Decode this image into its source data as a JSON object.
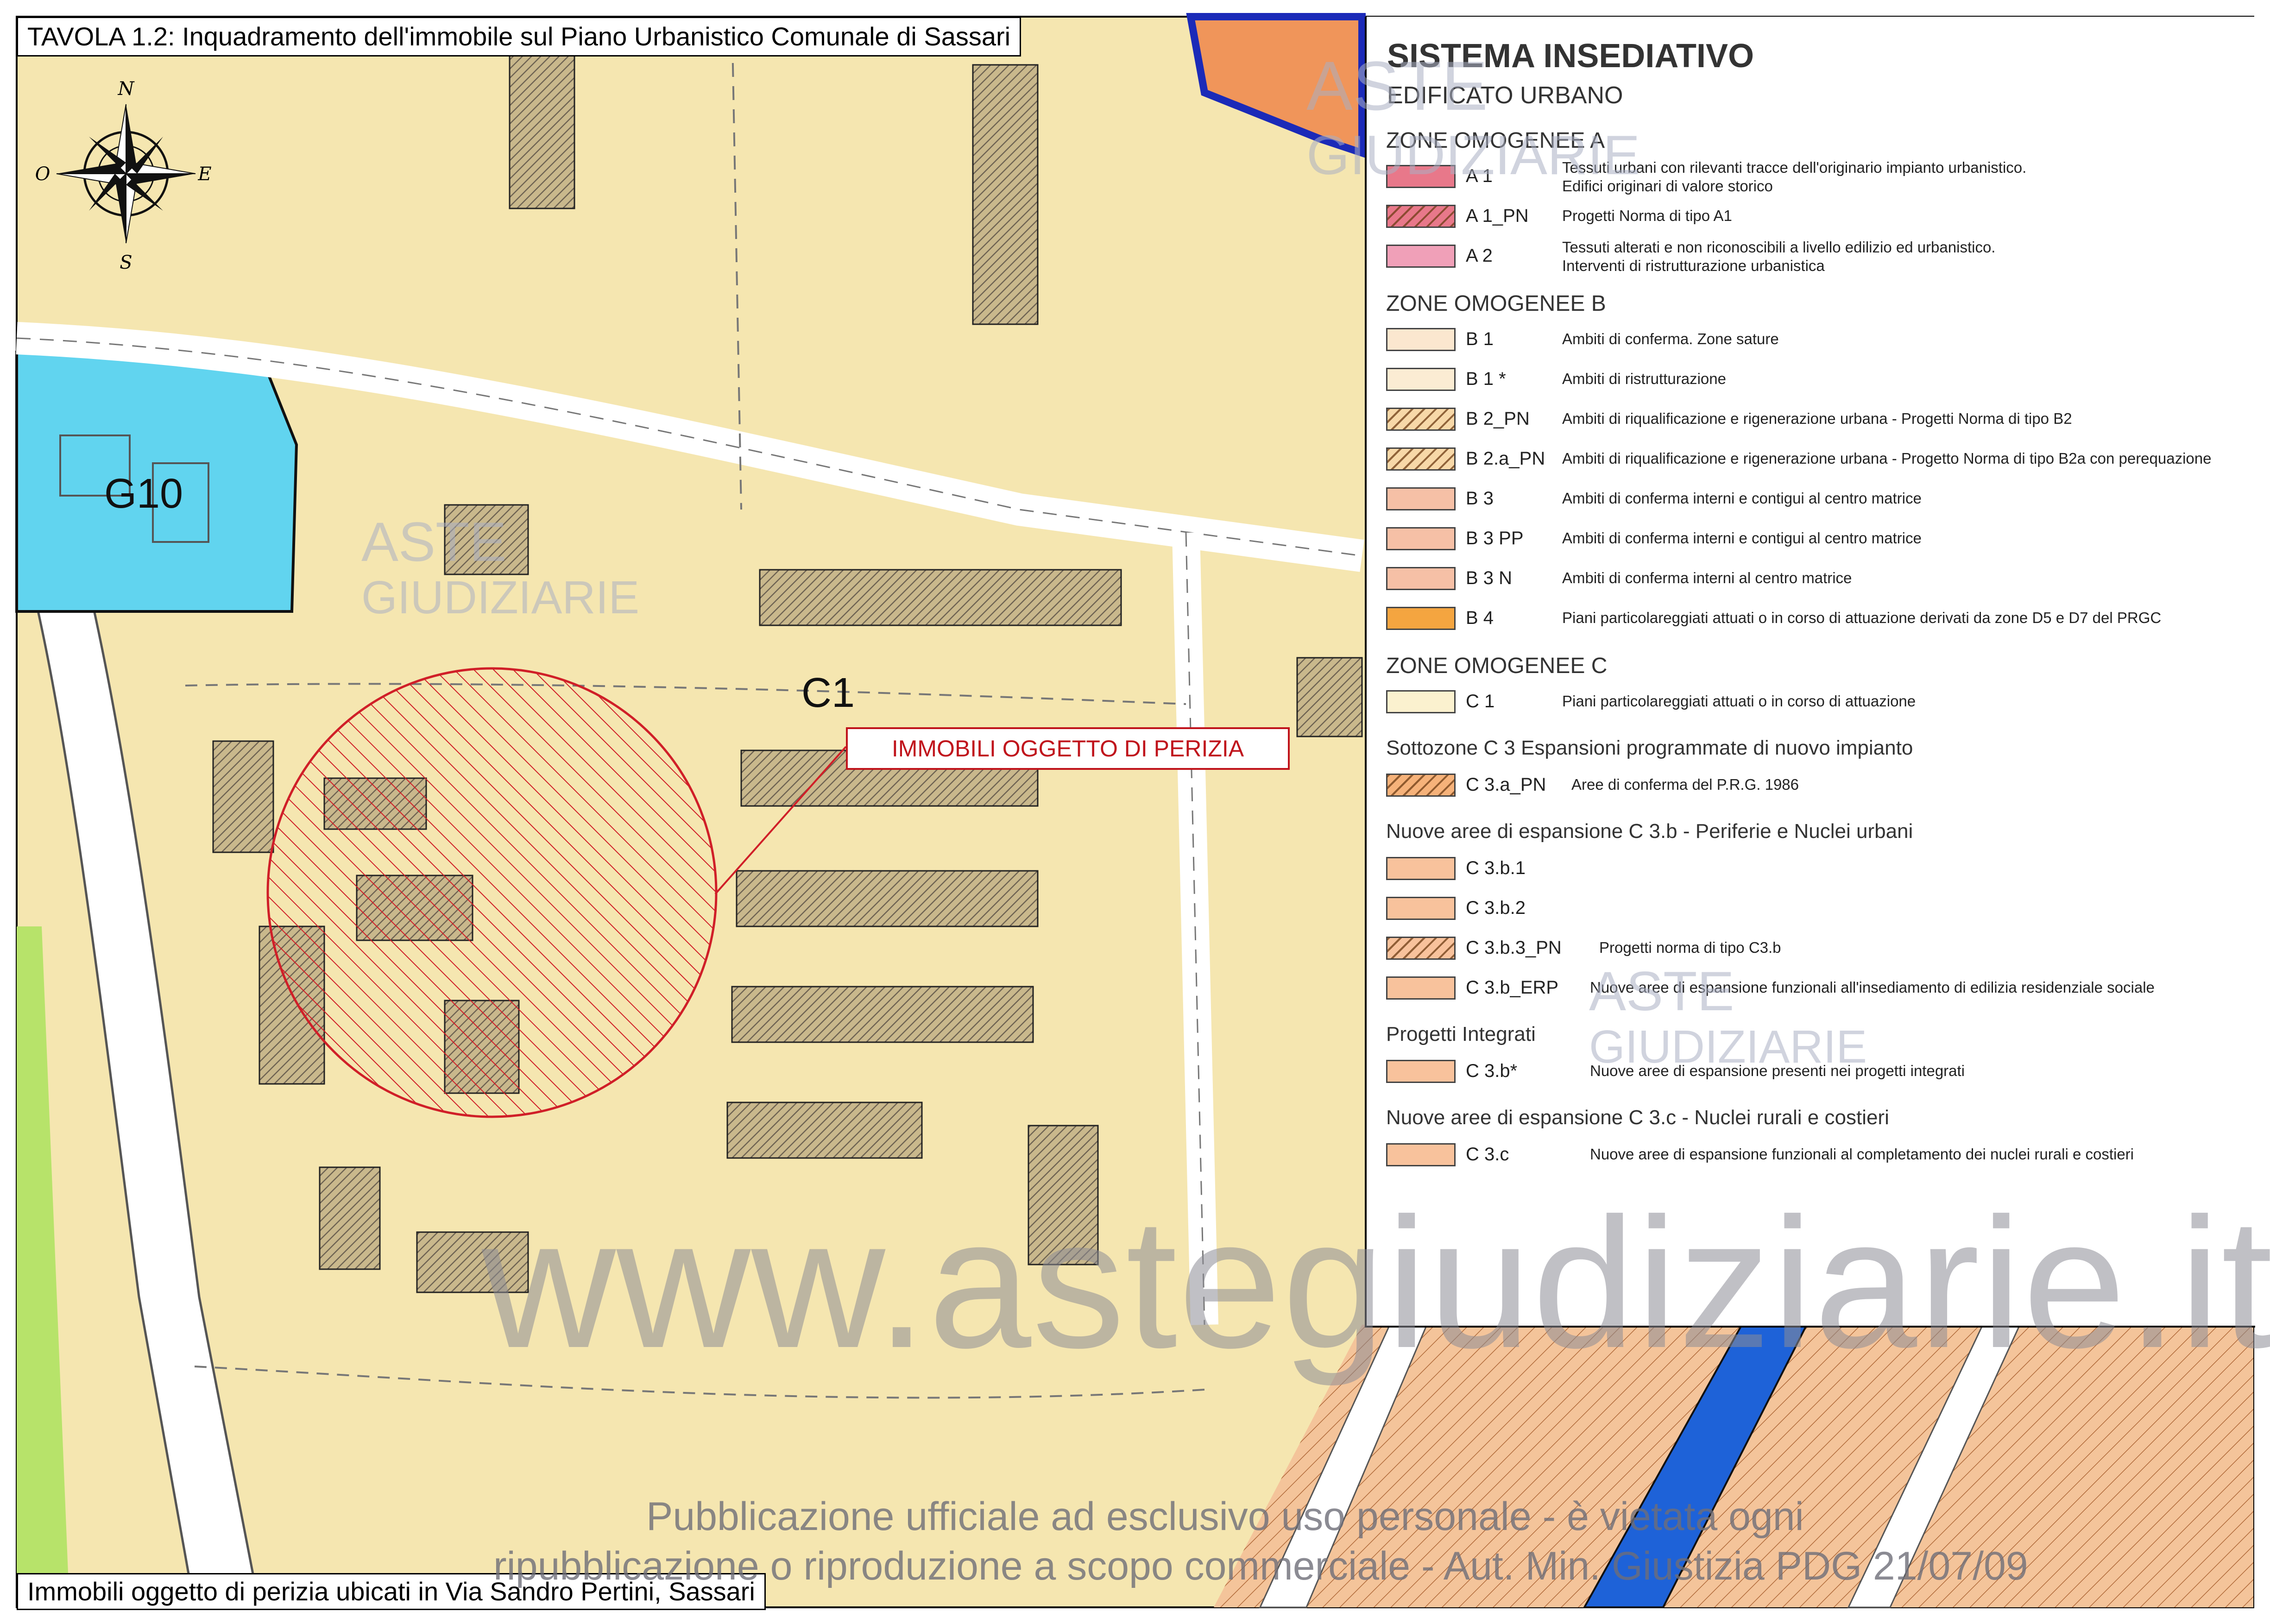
{
  "title": "TAVOLA 1.2: Inquadramento dell'immobile sul Piano Urbanistico Comunale di Sassari",
  "caption": "Immobili oggetto di perizia ubicati in Via Sandro Pertini, Sassari",
  "callout": "IMMOBILI OGGETTO DI PERIZIA",
  "compass": {
    "n": "N",
    "s": "S",
    "e": "E",
    "o": "O"
  },
  "zone_labels": {
    "g10": "G10",
    "c1": "C1"
  },
  "colors": {
    "map_base": "#f5e6b0",
    "service_zone": "#61d4ef",
    "highlight": "#d01f28",
    "road_blue": "#1e62d8",
    "green_strip": "#b7e36a",
    "building_hatch": "#b3a27a"
  },
  "legend": {
    "title": "SISTEMA INSEDIATIVO",
    "subtitle": "EDIFICATO URBANO",
    "sections": [
      {
        "heading": "ZONE OMOGENEE A",
        "items": [
          {
            "code": "A 1",
            "desc": "Tessuti urbani con rilevanti tracce dell'originario impianto urbanistico.",
            "desc2": "Edifici originari di valore storico",
            "color": "#e8788a",
            "hatch": false
          },
          {
            "code": "A 1_PN",
            "desc": "Progetti Norma di tipo A1",
            "desc2": "",
            "color": "#e8788a",
            "hatch": true
          },
          {
            "code": "A 2",
            "desc": "Tessuti alterati e non riconoscibili a livello edilizio ed urbanistico.",
            "desc2": "Interventi di ristrutturazione urbanistica",
            "color": "#f0a0b8",
            "hatch": false
          }
        ]
      },
      {
        "heading": "ZONE OMOGENEE B",
        "items": [
          {
            "code": "B 1",
            "desc": "Ambiti di conferma. Zone sature",
            "desc2": "",
            "color": "#fbe7cf",
            "hatch": false
          },
          {
            "code": "B 1 *",
            "desc": "Ambiti di ristrutturazione",
            "desc2": "",
            "color": "#fbecd3",
            "hatch": false
          },
          {
            "code": "B 2_PN",
            "desc": "Ambiti di riqualificazione e rigenerazione urbana - Progetti Norma di tipo B2",
            "desc2": "",
            "color": "#f7d8a8",
            "hatch": true
          },
          {
            "code": "B 2.a_PN",
            "desc": "Ambiti di riqualificazione e rigenerazione urbana - Progetto Norma di tipo B2a con perequazione",
            "desc2": "",
            "color": "#f7d8a8",
            "hatch": true
          },
          {
            "code": "B 3",
            "desc": "Ambiti di conferma interni e contigui al centro matrice",
            "desc2": "",
            "color": "#f6c0a6",
            "hatch": false
          },
          {
            "code": "B 3 PP",
            "desc": "Ambiti di conferma interni e contigui al centro matrice",
            "desc2": "",
            "color": "#f6c0a6",
            "hatch": false
          },
          {
            "code": "B 3 N",
            "desc": "Ambiti di conferma interni al centro matrice",
            "desc2": "",
            "color": "#f6c0a6",
            "hatch": false
          },
          {
            "code": "B 4",
            "desc": "Piani particolareggiati attuati o in corso di attuazione derivati da zone D5 e D7 del PRGC",
            "desc2": "",
            "color": "#f4a540",
            "hatch": false
          }
        ]
      },
      {
        "heading": "ZONE OMOGENEE C",
        "items": [
          {
            "code": "C 1",
            "desc": "Piani particolareggiati attuati o in corso di attuazione",
            "desc2": "",
            "color": "#fbf1cf",
            "hatch": false
          }
        ]
      },
      {
        "heading": "Sottozone C 3 Espansioni programmate di nuovo impianto",
        "items": [
          {
            "code": "C 3.a_PN",
            "desc": "Aree di conferma del P.R.G. 1986",
            "desc2": "",
            "color": "#f6b27a",
            "hatch": true
          }
        ]
      },
      {
        "heading": "Nuove aree di espansione C 3.b - Periferie e Nuclei urbani",
        "items": [
          {
            "code": "C 3.b.1",
            "desc": "",
            "desc2": "",
            "color": "#f8c29c",
            "hatch": false
          },
          {
            "code": "C 3.b.2",
            "desc": "",
            "desc2": "",
            "color": "#f8c29c",
            "hatch": false
          },
          {
            "code": "C 3.b.3_PN",
            "desc": "Progetti norma di tipo C3.b",
            "desc2": "",
            "color": "#f8c29c",
            "hatch": true
          },
          {
            "code": "C 3.b_ERP",
            "desc": "Nuove aree di espansione funzionali all'insediamento di edilizia residenziale sociale",
            "desc2": "",
            "color": "#f8c29c",
            "hatch": false
          }
        ]
      },
      {
        "heading": "Progetti Integrati",
        "items": [
          {
            "code": "C 3.b*",
            "desc": "Nuove aree di espansione presenti nei progetti integrati",
            "desc2": "",
            "color": "#f8c29c",
            "hatch": false
          }
        ]
      },
      {
        "heading": "Nuove aree di espansione C 3.c - Nuclei rurali e costieri",
        "items": [
          {
            "code": "C 3.c",
            "desc": "Nuove aree di espansione funzionali al completamento dei nuclei rurali e costieri",
            "desc2": "",
            "color": "#f8c29c",
            "hatch": false
          }
        ]
      }
    ]
  },
  "watermark": {
    "site": "www.astegiudiziarie.it",
    "line1": "Pubblicazione ufficiale ad esclusivo uso personale - è vietata ogni",
    "line2": "ripubblicazione o riproduzione a scopo commerciale - Aut. Min. Giustizia PDG 21/07/09",
    "logo1": "ASTE",
    "logo2": "GIUDIZIARIE"
  }
}
